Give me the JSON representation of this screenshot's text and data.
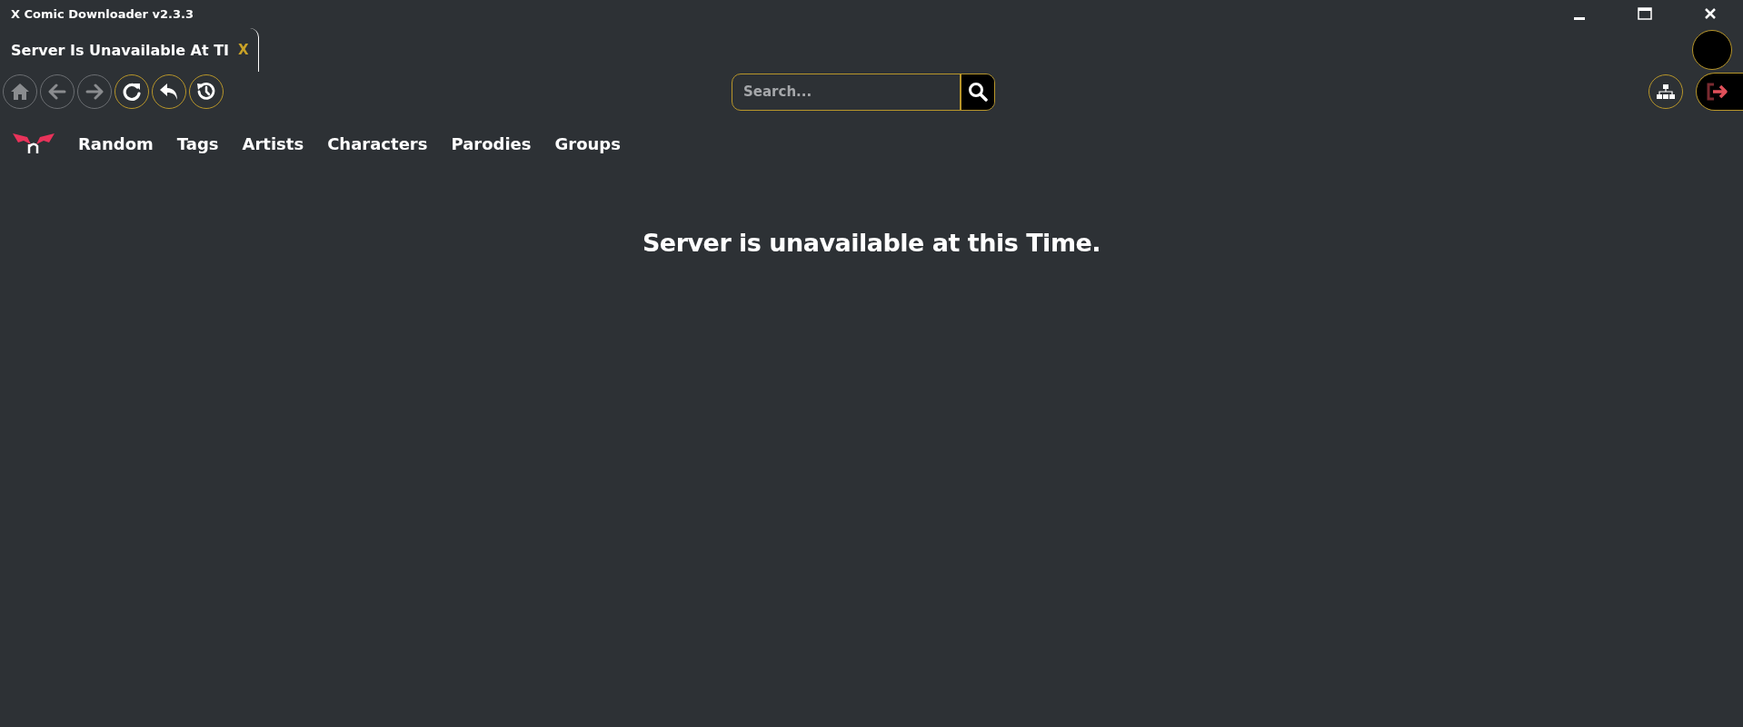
{
  "window": {
    "title": "X Comic Downloader v2.3.3"
  },
  "tab": {
    "label": "Server Is Unavailable At TI",
    "close": "X"
  },
  "nav_buttons": [
    {
      "kind": "home",
      "disabled": true
    },
    {
      "kind": "back",
      "disabled": true
    },
    {
      "kind": "forward",
      "disabled": true
    },
    {
      "kind": "reload",
      "disabled": false
    },
    {
      "kind": "undo",
      "disabled": false
    },
    {
      "kind": "history",
      "disabled": false
    }
  ],
  "search": {
    "placeholder": "Search..."
  },
  "menu": [
    "Random",
    "Tags",
    "Artists",
    "Characters",
    "Parodies",
    "Groups"
  ],
  "message": "Server is unavailable at this Time."
}
